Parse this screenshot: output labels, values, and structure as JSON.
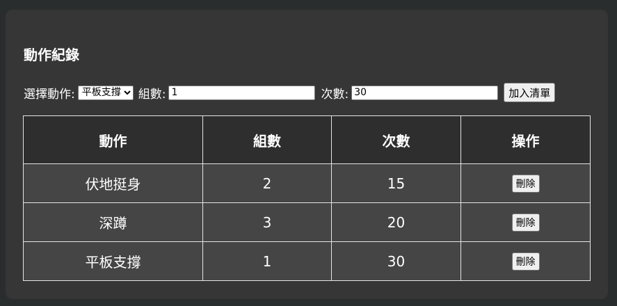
{
  "title": "動作紀錄",
  "form": {
    "exercise_label": "選擇動作:",
    "exercise_selected": "平板支撐",
    "sets_label": "組數:",
    "sets_value": "1",
    "reps_label": "次數:",
    "reps_value": "30",
    "add_button": "加入清單"
  },
  "table": {
    "headers": [
      "動作",
      "組數",
      "次數",
      "操作"
    ],
    "rows": [
      {
        "exercise": "伏地挺身",
        "sets": "2",
        "reps": "15",
        "action": "刪除"
      },
      {
        "exercise": "深蹲",
        "sets": "3",
        "reps": "20",
        "action": "刪除"
      },
      {
        "exercise": "平板支撐",
        "sets": "1",
        "reps": "30",
        "action": "刪除"
      }
    ]
  }
}
